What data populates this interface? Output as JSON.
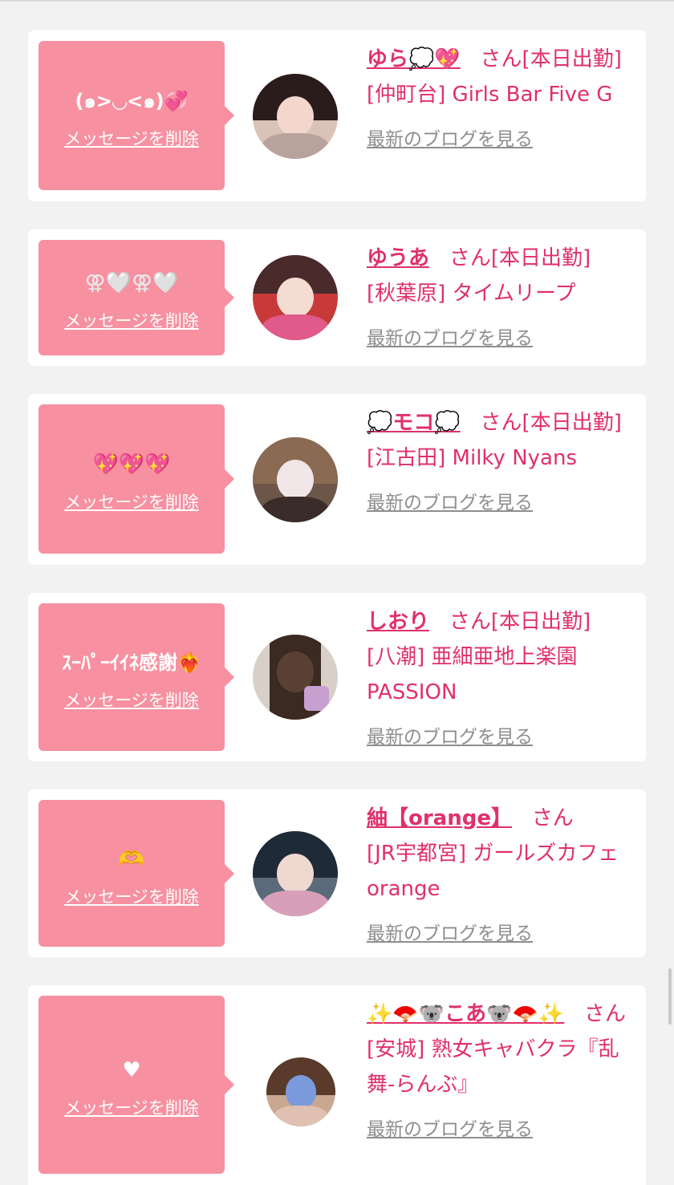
{
  "common": {
    "delete_label": "メッセージを削除",
    "blog_label": "最新のブログを見る"
  },
  "cards": [
    {
      "message": "(๑>◡<๑)💞",
      "name": "ゆら💭💖",
      "suffix": "さん[本日出勤]",
      "shop": "[仲町台] Girls Bar Five G"
    },
    {
      "message": "⚢🤍⚢🤍",
      "name": "ゆうあ",
      "suffix": "さん[本日出勤]",
      "shop": "[秋葉原] タイムリープ"
    },
    {
      "message": "💖💖💖",
      "name": "💭モコ💭",
      "suffix": "さん[本日出勤]",
      "shop": "[江古田] Milky Nyans"
    },
    {
      "message": "ｽｰﾊﾟｰｲｲﾈ感謝❤️‍🔥",
      "name": "しおり",
      "suffix": "さん[本日出勤]",
      "shop": "[八潮] 亜細亜地上楽園PASSION"
    },
    {
      "message": "🫶",
      "name": "紬【orange】",
      "suffix": "さん",
      "shop": "[JR宇都宮] ガールズカフェ orange"
    },
    {
      "message": "♥",
      "name": "✨🪭🐨こあ🐨🪭✨",
      "suffix": "さん",
      "shop": "[安城] 熟女キャバクラ『乱舞-らんぶ』"
    }
  ],
  "colors": {
    "bubble": "#f790a0",
    "accent": "#e0306a",
    "link_gray": "#8e8e8e",
    "background": "#f2f2f2"
  }
}
